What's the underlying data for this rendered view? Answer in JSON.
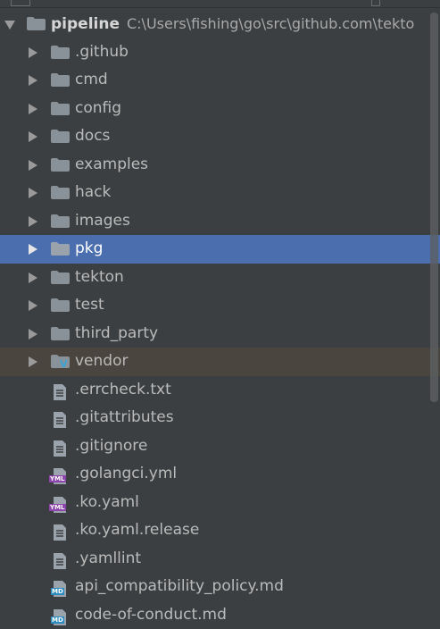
{
  "colors": {
    "background": "#3c3f41",
    "selection": "#4b6eaf",
    "ignored_row": "#4a453e",
    "folder": "#8a9299",
    "text": "#bbbbbb",
    "yml_badge": "#8e44ad",
    "md_badge": "#2e8bc0",
    "vendor_badge": "#38a5d6"
  },
  "root": {
    "name": "pipeline",
    "path": "C:\\Users\\fishing\\go\\src\\github.com\\tekto",
    "expanded": true,
    "icon": "folder-icon"
  },
  "folders": [
    {
      "label": ".github",
      "icon": "folder-icon"
    },
    {
      "label": "cmd",
      "icon": "folder-icon"
    },
    {
      "label": "config",
      "icon": "folder-icon"
    },
    {
      "label": "docs",
      "icon": "folder-icon"
    },
    {
      "label": "examples",
      "icon": "folder-icon"
    },
    {
      "label": "hack",
      "icon": "folder-icon"
    },
    {
      "label": "images",
      "icon": "folder-icon"
    },
    {
      "label": "pkg",
      "icon": "folder-icon",
      "selected": true
    },
    {
      "label": "tekton",
      "icon": "folder-icon"
    },
    {
      "label": "test",
      "icon": "folder-icon"
    },
    {
      "label": "third_party",
      "icon": "folder-icon"
    },
    {
      "label": "vendor",
      "icon": "vendor-folder-icon",
      "badge": "V"
    }
  ],
  "files": [
    {
      "label": ".errcheck.txt",
      "icon": "text-file-icon"
    },
    {
      "label": ".gitattributes",
      "icon": "text-file-icon"
    },
    {
      "label": ".gitignore",
      "icon": "text-file-icon"
    },
    {
      "label": ".golangci.yml",
      "icon": "yaml-file-icon",
      "badge": "YML"
    },
    {
      "label": ".ko.yaml",
      "icon": "yaml-file-icon",
      "badge": "YML"
    },
    {
      "label": ".ko.yaml.release",
      "icon": "text-file-icon"
    },
    {
      "label": ".yamllint",
      "icon": "text-file-icon"
    },
    {
      "label": "api_compatibility_policy.md",
      "icon": "markdown-file-icon",
      "badge": "MD"
    },
    {
      "label": "code-of-conduct.md",
      "icon": "markdown-file-icon",
      "badge": "MD"
    }
  ]
}
